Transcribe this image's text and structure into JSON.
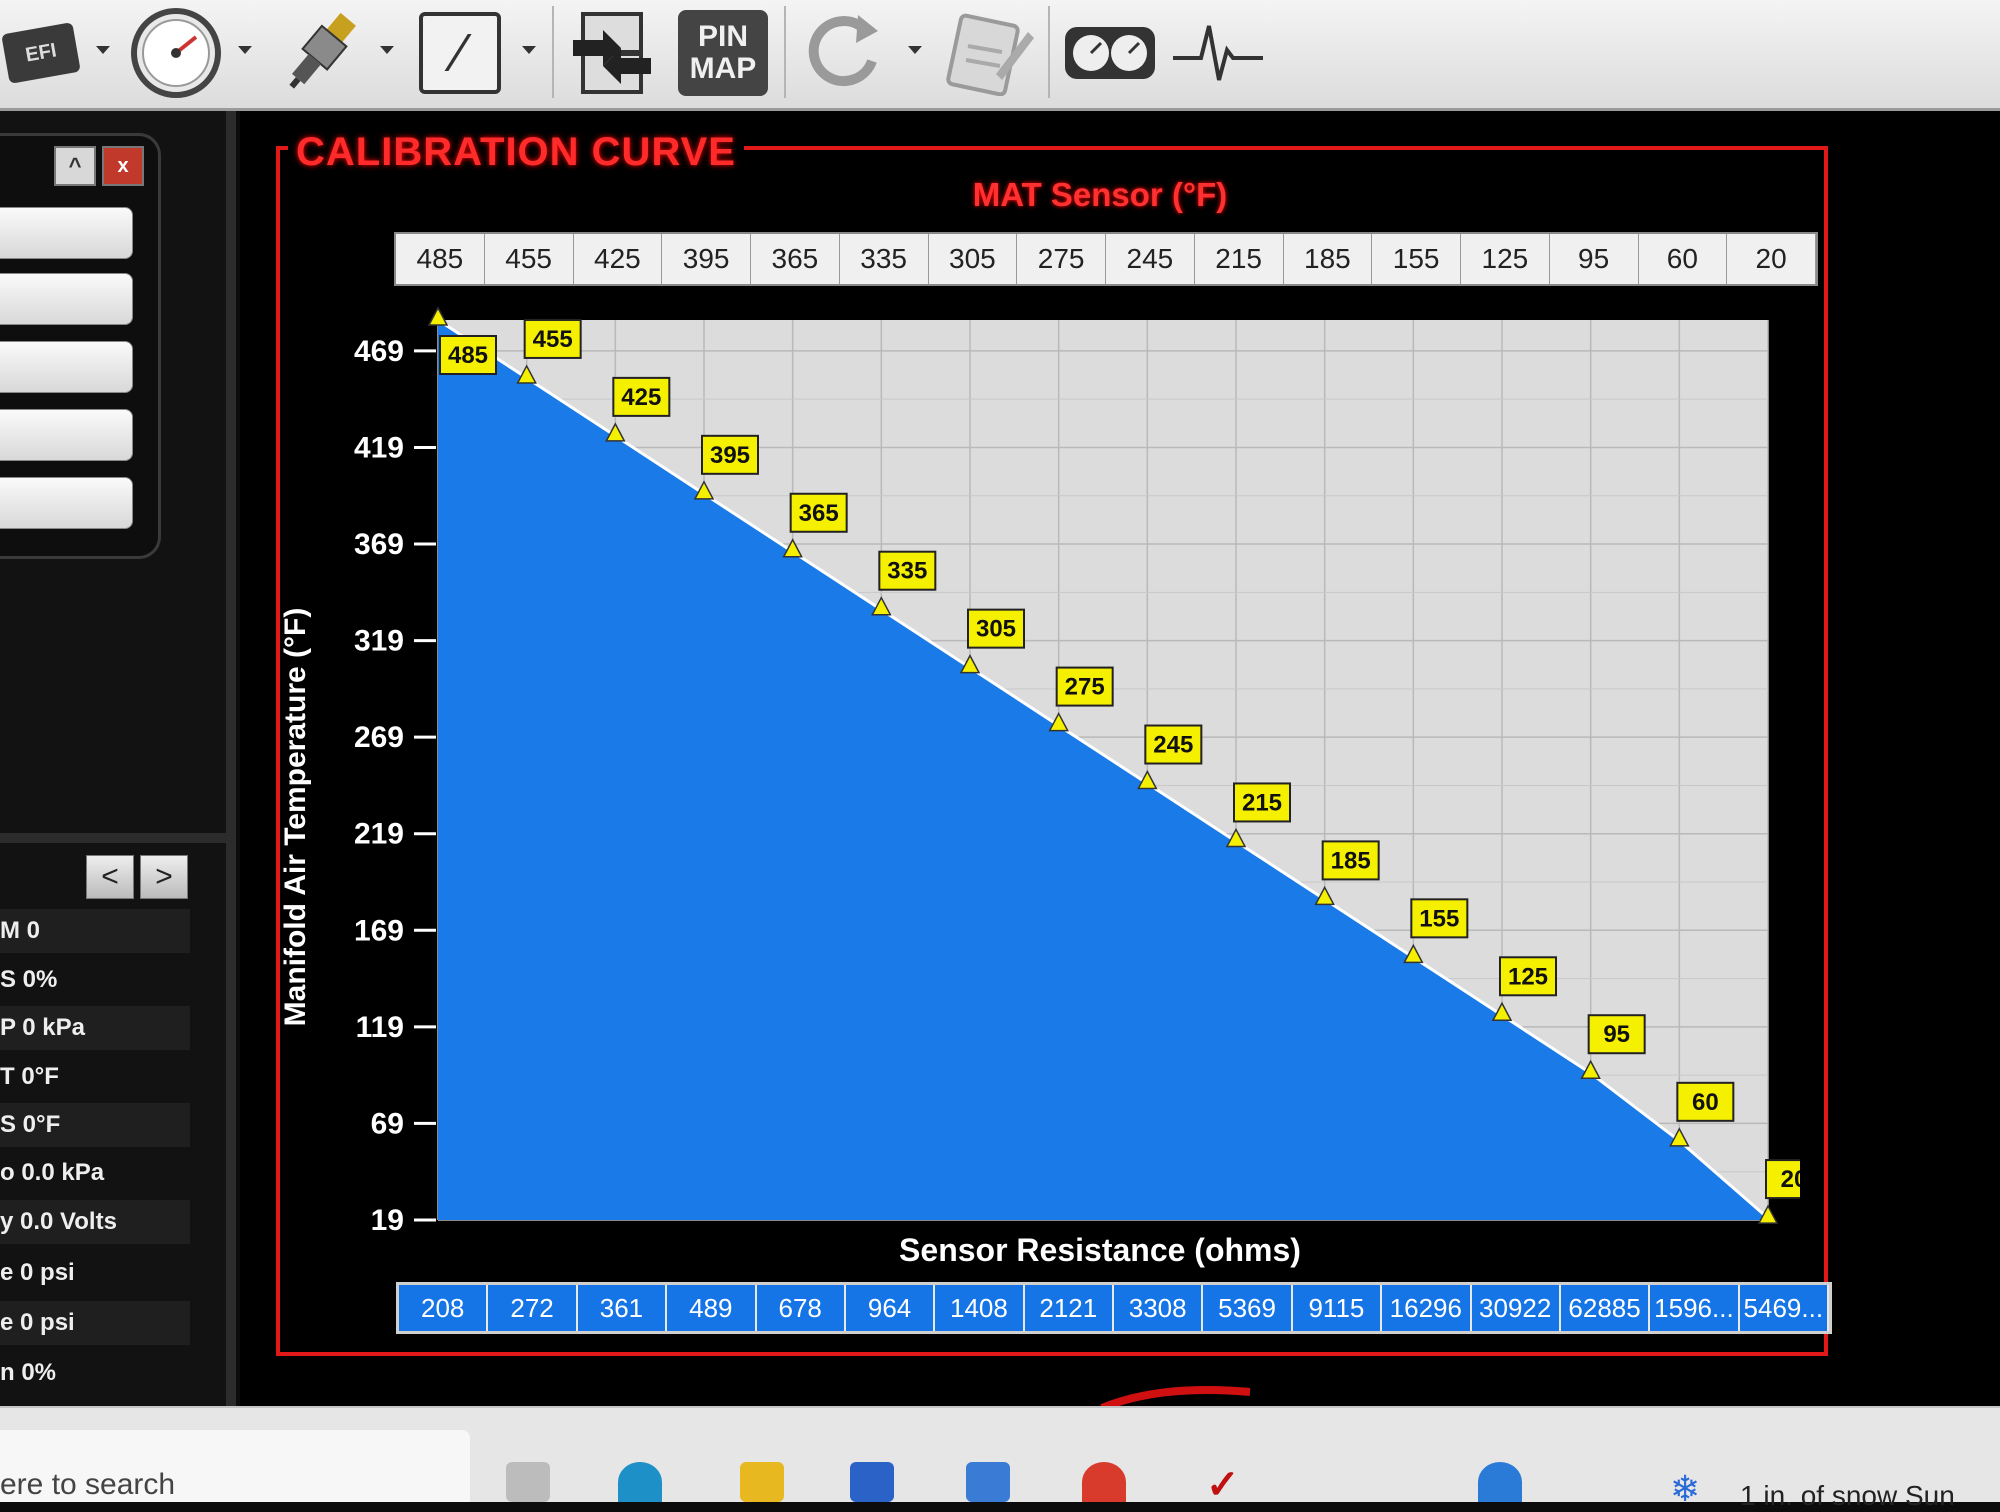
{
  "toolbar": {
    "efi_logo_text": "EFI",
    "pin_map_line1": "PIN",
    "pin_map_line2": "MAP"
  },
  "left_panel": {
    "close_label": "x",
    "collapse_label": "^",
    "nav_prev": "<",
    "nav_next": ">",
    "gauges": [
      "M 0",
      "S 0%",
      "P 0 kPa",
      "T 0°F",
      "S 0°F",
      "o 0.0 kPa",
      "y 0.0 Volts",
      "e 0 psi",
      "e 0 psi",
      "n 0%"
    ]
  },
  "panel": {
    "title": "CALIBRATION CURVE",
    "sensor_title": "MAT Sensor (°F)",
    "y_axis_label": "Manifold Air Temperature (°F)",
    "x_axis_label": "Sensor Resistance (ohms)"
  },
  "temp_row": [
    "485",
    "455",
    "425",
    "395",
    "365",
    "335",
    "305",
    "275",
    "245",
    "215",
    "185",
    "155",
    "125",
    "95",
    "60",
    "20"
  ],
  "ohm_row": [
    "208",
    "272",
    "361",
    "489",
    "678",
    "964",
    "1408",
    "2121",
    "3308",
    "5369",
    "9115",
    "16296",
    "30922",
    "62885",
    "1596...",
    "5469..."
  ],
  "chart_data": {
    "type": "area",
    "x_label": "Sensor Resistance (ohms)",
    "y_label": "Manifold Air Temperature (°F)",
    "y_ticks": [
      469,
      419,
      369,
      319,
      269,
      219,
      169,
      119,
      69,
      19
    ],
    "ylim": [
      19,
      485
    ],
    "categories": [
      "208",
      "272",
      "361",
      "489",
      "678",
      "964",
      "1408",
      "2121",
      "3308",
      "5369",
      "9115",
      "16296",
      "30922",
      "62885",
      "1596...",
      "5469..."
    ],
    "values": [
      485,
      455,
      425,
      395,
      365,
      335,
      305,
      275,
      245,
      215,
      185,
      155,
      125,
      95,
      60,
      20
    ],
    "fill_color": "#1a7ae8",
    "point_label_color": "#f5f000",
    "grid": true
  },
  "taskbar": {
    "search_text": "ere to search",
    "weather_text": "1 in. of snow Sun"
  },
  "colors": {
    "frame_red": "#e01818",
    "title_red": "#ff2b2b",
    "curve_blue": "#1a7ae8",
    "label_yellow": "#f5f000"
  }
}
